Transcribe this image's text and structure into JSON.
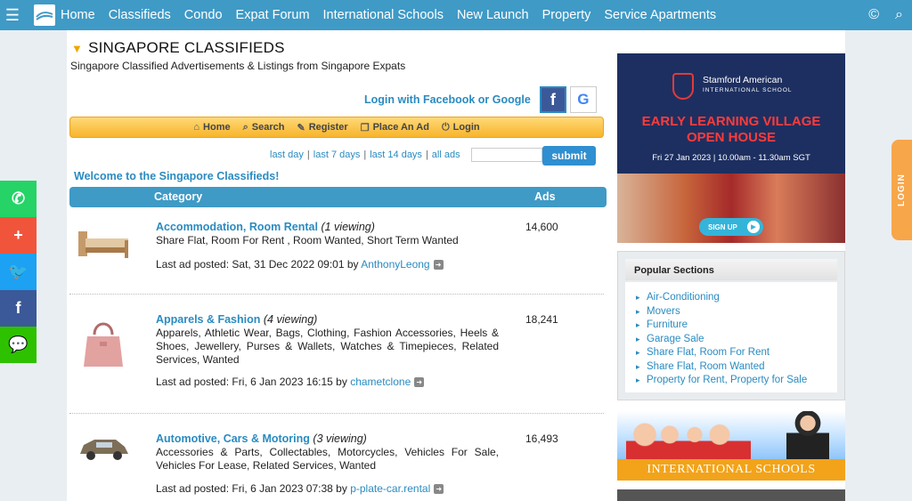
{
  "nav": {
    "items": [
      "Home",
      "Classifieds",
      "Condo",
      "Expat Forum",
      "International Schools",
      "New Launch",
      "Property",
      "Service Apartments"
    ]
  },
  "page": {
    "title": "SINGAPORE CLASSIFIEDS",
    "subtitle": "Singapore Classified Advertisements & Listings from Singapore Expats",
    "login_text": "Login with Facebook or Google",
    "fb_glyph": "f",
    "google_glyph": "G",
    "welcome": "Welcome to the Singapore Classifieds!"
  },
  "toolbar": {
    "items": [
      {
        "label": "Home",
        "icon": "home-icon",
        "glyph": "⌂"
      },
      {
        "label": "Search",
        "icon": "search-icon",
        "glyph": "⌕"
      },
      {
        "label": "Register",
        "icon": "register-icon",
        "glyph": "✎"
      },
      {
        "label": "Place An Ad",
        "icon": "place-ad-icon",
        "glyph": "❐"
      },
      {
        "label": "Login",
        "icon": "login-icon",
        "glyph": "⏻"
      }
    ]
  },
  "filters": {
    "links": [
      "last day",
      "last 7 days",
      "last 14 days",
      "all ads"
    ],
    "submit_label": "submit"
  },
  "table": {
    "header_category": "Category",
    "header_ads": "Ads",
    "last_ad_prefix": "Last ad posted:",
    "by": "by",
    "rows": [
      {
        "name": "Accommodation, Room Rental",
        "viewing": "(1 viewing)",
        "description": "Share Flat, Room For Rent , Room Wanted, Short Term Wanted",
        "count": "14,600",
        "last_posted": "Sat, 31 Dec 2022 09:01",
        "user": "AnthonyLeong"
      },
      {
        "name": "Apparels & Fashion",
        "viewing": "(4 viewing)",
        "description": "Apparels, Athletic Wear, Bags, Clothing, Fashion Accessories, Heels & Shoes, Jewellery, Purses & Wallets, Watches & Timepieces, Related Services, Wanted",
        "count": "18,241",
        "last_posted": "Fri, 6 Jan 2023 16:15",
        "user": "chametclone"
      },
      {
        "name": "Automotive, Cars & Motoring",
        "viewing": "(3 viewing)",
        "description": "Accessories & Parts, Collectables, Motorcycles, Vehicles For Sale, Vehicles For Lease, Related Services, Wanted",
        "count": "16,493",
        "last_posted": "Fri, 6 Jan 2023 07:38",
        "user": "p-plate-car.rental"
      }
    ]
  },
  "ad": {
    "school_name": "Stamford American",
    "school_sub": "INTERNATIONAL SCHOOL",
    "headline_1": "EARLY LEARNING VILLAGE",
    "headline_2": "OPEN HOUSE",
    "date": "Fri 27 Jan 2023 | 10.00am - 11.30am SGT",
    "signup": "SIGN UP"
  },
  "popular": {
    "title": "Popular Sections",
    "items": [
      "Air-Conditioning",
      "Movers",
      "Furniture",
      "Garage Sale",
      "Share Flat, Room For Rent",
      "Share Flat, Room Wanted",
      "Property for Rent, Property for Sale"
    ]
  },
  "intl_banner": {
    "label": "INTERNATIONAL SCHOOLS"
  },
  "social": {
    "items": [
      {
        "name": "whatsapp-icon",
        "glyph": "✆",
        "color": "#25d366"
      },
      {
        "name": "add-share-icon",
        "glyph": "+",
        "color": "#f0553c"
      },
      {
        "name": "twitter-icon",
        "glyph": "🐦",
        "color": "#1da1f2"
      },
      {
        "name": "facebook-icon",
        "glyph": "f",
        "color": "#3b5998"
      },
      {
        "name": "wechat-icon",
        "glyph": "💬",
        "color": "#2dc100"
      }
    ]
  },
  "login_tab": "LOGIN",
  "colors": {
    "nav": "#3f9ac6",
    "link": "#2a8bc0",
    "accent_orange": "#f7b42c"
  }
}
